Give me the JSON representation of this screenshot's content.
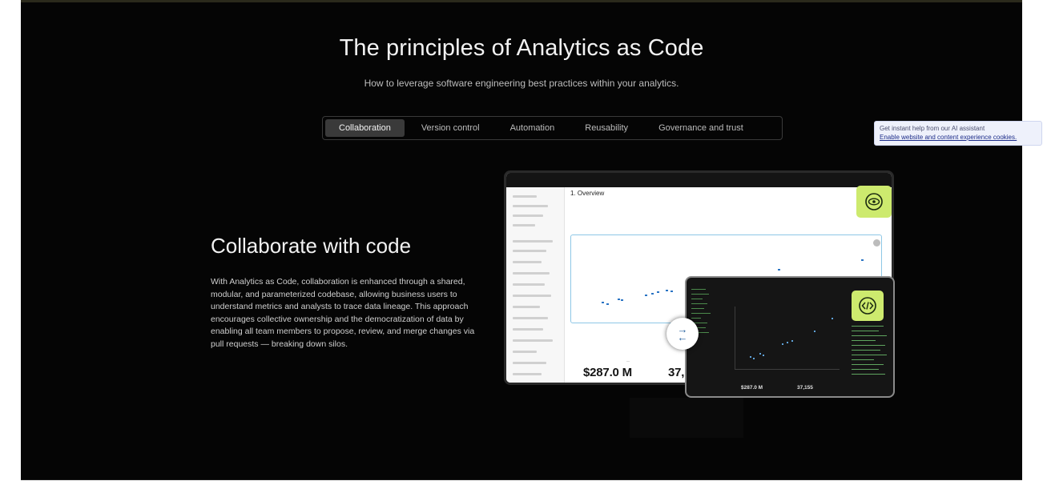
{
  "hero": {
    "title": "The principles of Analytics as Code",
    "subtitle": "How to leverage software engineering best practices within your analytics."
  },
  "tabs": [
    {
      "label": "Collaboration",
      "active": true
    },
    {
      "label": "Version control",
      "active": false
    },
    {
      "label": "Automation",
      "active": false
    },
    {
      "label": "Reusability",
      "active": false
    },
    {
      "label": "Governance and trust",
      "active": false
    }
  ],
  "section": {
    "title": "Collaborate with code",
    "body": "With Analytics as Code, collaboration is enhanced through a shared, modular, and parameterized codebase, allowing business users to understand metrics and analysts to trace data lineage. This approach encourages collective ownership and the democratization of data by enabling all team members to propose, review, and merge changes via pull requests — breaking down silos."
  },
  "dashboard_preview": {
    "heading": "1. Overview",
    "kpi_primary": "$287.0 M",
    "kpi_secondary": "37,"
  },
  "code_preview": {
    "kpi_primary": "$287.0 M",
    "kpi_secondary": "37,155"
  },
  "icons": {
    "view": "eye-icon",
    "code": "code-icon",
    "swap": "swap-arrows-icon"
  },
  "ai_banner": {
    "help_text": "Get instant help from our AI assistant",
    "link_text": "Enable website and content experience cookies."
  },
  "colors": {
    "background": "#050505",
    "accent_badge": "#cdea6e",
    "active_tab": "#3a3a3a",
    "banner_bg": "#eef1fb"
  }
}
